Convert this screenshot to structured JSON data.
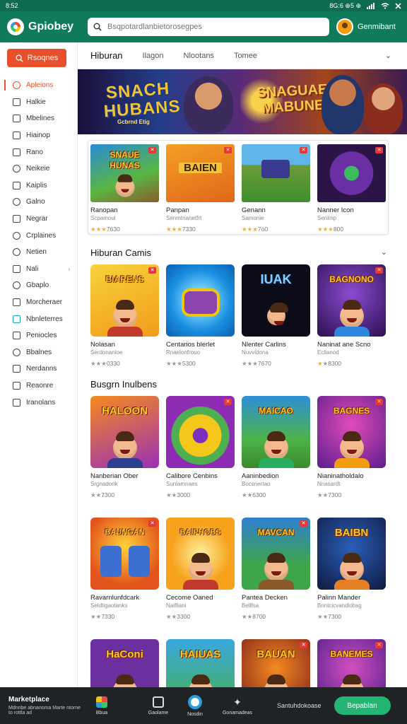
{
  "status_bar": {
    "time": "8:52",
    "right_text": "8G:6 ⊕5 ⊕",
    "signal_icon": "signal-icon",
    "wifi_icon": "wifi-icon",
    "close_icon": "close-icon"
  },
  "header": {
    "app_name": "Gpiobey",
    "search_placeholder": "Bsqpotardlanbietorosegpes",
    "account_name": "Genmibant"
  },
  "sidebar": {
    "cta_label": "Rsoqnes",
    "items": [
      {
        "label": "Apleions",
        "active": true
      },
      {
        "label": "Halkie"
      },
      {
        "label": "Mbelines"
      },
      {
        "label": "Hiainop"
      },
      {
        "label": "Rano"
      },
      {
        "label": "Neikeie"
      },
      {
        "label": "Kaiplis"
      },
      {
        "label": "Galno"
      },
      {
        "label": "Negrar"
      },
      {
        "label": "Crplaines"
      },
      {
        "label": "Netien"
      },
      {
        "label": "Nali",
        "chevron": "›"
      },
      {
        "label": "Gbaplo"
      },
      {
        "label": "Morcheraer"
      },
      {
        "label": "Nbnleterres"
      },
      {
        "label": "Peniocles"
      },
      {
        "label": "Bbalnes"
      },
      {
        "label": "Nerdanns"
      },
      {
        "label": "Reaonre"
      },
      {
        "label": "Iranolans"
      }
    ]
  },
  "tabs": [
    {
      "label": "Hiburan",
      "active": true
    },
    {
      "label": "Ilagon"
    },
    {
      "label": "Nlootans"
    },
    {
      "label": "Tomee"
    }
  ],
  "banner": {
    "title_left": "SNACH HUBANS",
    "subtitle_left": "Gcbrnd Etig",
    "title_right": "SNAGUAE MABUNE"
  },
  "featured": [
    {
      "art": "SNAUE HUNAS",
      "title": "Ranopan",
      "sub": "Scpamoul",
      "rating": "★★★7630",
      "stars": 3,
      "score": "7630"
    },
    {
      "art": "BAIEN",
      "title": "Panpan",
      "sub": "Senmtnanetfrt",
      "rating": "★★★7330",
      "stars": 3,
      "score": "7330"
    },
    {
      "art": "",
      "title": "Genann",
      "sub": "Samonie",
      "rating": "★★★7ö0",
      "stars": 3,
      "score": "7ö0"
    },
    {
      "art": "",
      "title": "Nanner Icon",
      "sub": "Senlmp",
      "rating": "★★★800",
      "stars": 3,
      "score": "800"
    }
  ],
  "section_games": {
    "title": "Hiburan Camis",
    "items": [
      {
        "art": "BIARENS",
        "title": "Nolasan",
        "sub": "Serdonanloe",
        "score": "0330",
        "stars": 2
      },
      {
        "art": "",
        "title": "Centarios blerlet",
        "sub": "Rnaelonfrouo",
        "score": "5300",
        "stars": 2
      },
      {
        "art": "IUAK",
        "title": "Nlenter Carlins",
        "sub": "Nuvvidona",
        "score": "7670",
        "stars": 2
      },
      {
        "art": "BAGNONO",
        "title": "Naninat ane Scno",
        "sub": "Ecllanod",
        "score": "8300",
        "stars": 2
      }
    ]
  },
  "section_bugs": {
    "title": "Busgrn Inulbens",
    "items": [
      {
        "art": "HALOON",
        "title": "Nanberian Ober",
        "sub": "Srgnadonk",
        "score": "7300",
        "stars": 2
      },
      {
        "art": "",
        "title": "Calibore Cenbins",
        "sub": "Sunlamnaes",
        "score": "3000",
        "stars": 2
      },
      {
        "art": "MAICAO",
        "title": "Aaninbedion",
        "sub": "Bocsnertao",
        "score": "6300",
        "stars": 2
      },
      {
        "art": "BAGNES",
        "title": "Nianinatholdalo",
        "sub": "Nnasardt",
        "score": "7300",
        "stars": 2
      }
    ]
  },
  "section_more": {
    "items": [
      {
        "art": "BAUNGAN",
        "title": "Ravarnlunfdcark",
        "sub": "Seldtigaotanks",
        "score": "7330",
        "stars": 2
      },
      {
        "art": "BAIPHOBS",
        "title": "Cecome Oaned",
        "sub": "Naifliani",
        "score": "3300",
        "stars": 2
      },
      {
        "art": "MAVCAN",
        "title": "Pantea Decken",
        "sub": "Bellfsa",
        "score": "8700",
        "stars": 2
      },
      {
        "art": "BAIBN",
        "title": "Palinn Mander",
        "sub": "Bnntcicvandlobsg",
        "score": "7300",
        "stars": 2
      }
    ]
  },
  "section_last": {
    "items": [
      {
        "art": "HaConi"
      },
      {
        "art": "HAIUAS"
      },
      {
        "art": "BAUAN"
      },
      {
        "art": "BANEMES"
      }
    ]
  },
  "bottom_bar": {
    "brand_title": "Marketplace",
    "brand_sub": "Mdnnbe abnanoma Marte ntorne to rottla ad",
    "items": [
      {
        "label": "Bbua",
        "icon": "apps-icon"
      },
      {
        "label": "Gaolame",
        "icon": "games-icon"
      },
      {
        "label": "Nosdin",
        "icon": "home-icon",
        "active": true
      },
      {
        "label": "Gonamadeas",
        "icon": "star-icon"
      }
    ],
    "text_link": "Santuhdokoase",
    "button_label": "Bepablan"
  },
  "colors": {
    "header_green": "#0f7b5a",
    "accent_orange": "#e8502c",
    "cta_green": "#22b573",
    "dark_bar": "#1f2326"
  }
}
